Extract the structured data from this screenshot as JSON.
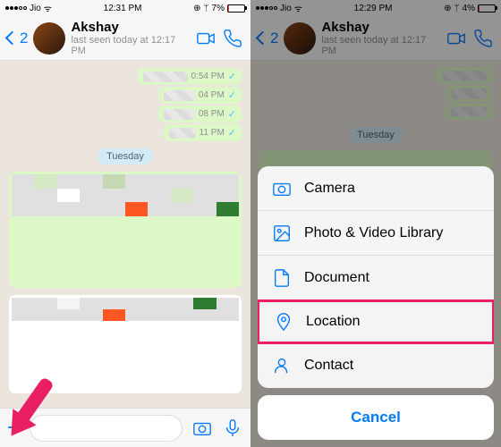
{
  "left": {
    "statusbar": {
      "carrier": "Jio",
      "time": "12:31 PM",
      "battery_pct": "7%",
      "battery_fill": 7
    },
    "header": {
      "back_count": "2",
      "name": "Akshay",
      "status": "last seen today at 12:17 PM"
    },
    "bubbles": [
      {
        "time": "0:54 PM"
      },
      {
        "time": "04 PM"
      },
      {
        "time": "08 PM"
      },
      {
        "time": "11 PM"
      }
    ],
    "day_chip": "Tuesday"
  },
  "right": {
    "statusbar": {
      "carrier": "Jio",
      "time": "12:29 PM",
      "battery_pct": "4%",
      "battery_fill": 4
    },
    "header": {
      "back_count": "2",
      "name": "Akshay",
      "status": "last seen today at 12:17 PM"
    },
    "day_chip": "Tuesday",
    "sheet": {
      "items": [
        {
          "label": "Camera"
        },
        {
          "label": "Photo & Video Library"
        },
        {
          "label": "Document"
        },
        {
          "label": "Location"
        },
        {
          "label": "Contact"
        }
      ],
      "cancel": "Cancel"
    }
  }
}
